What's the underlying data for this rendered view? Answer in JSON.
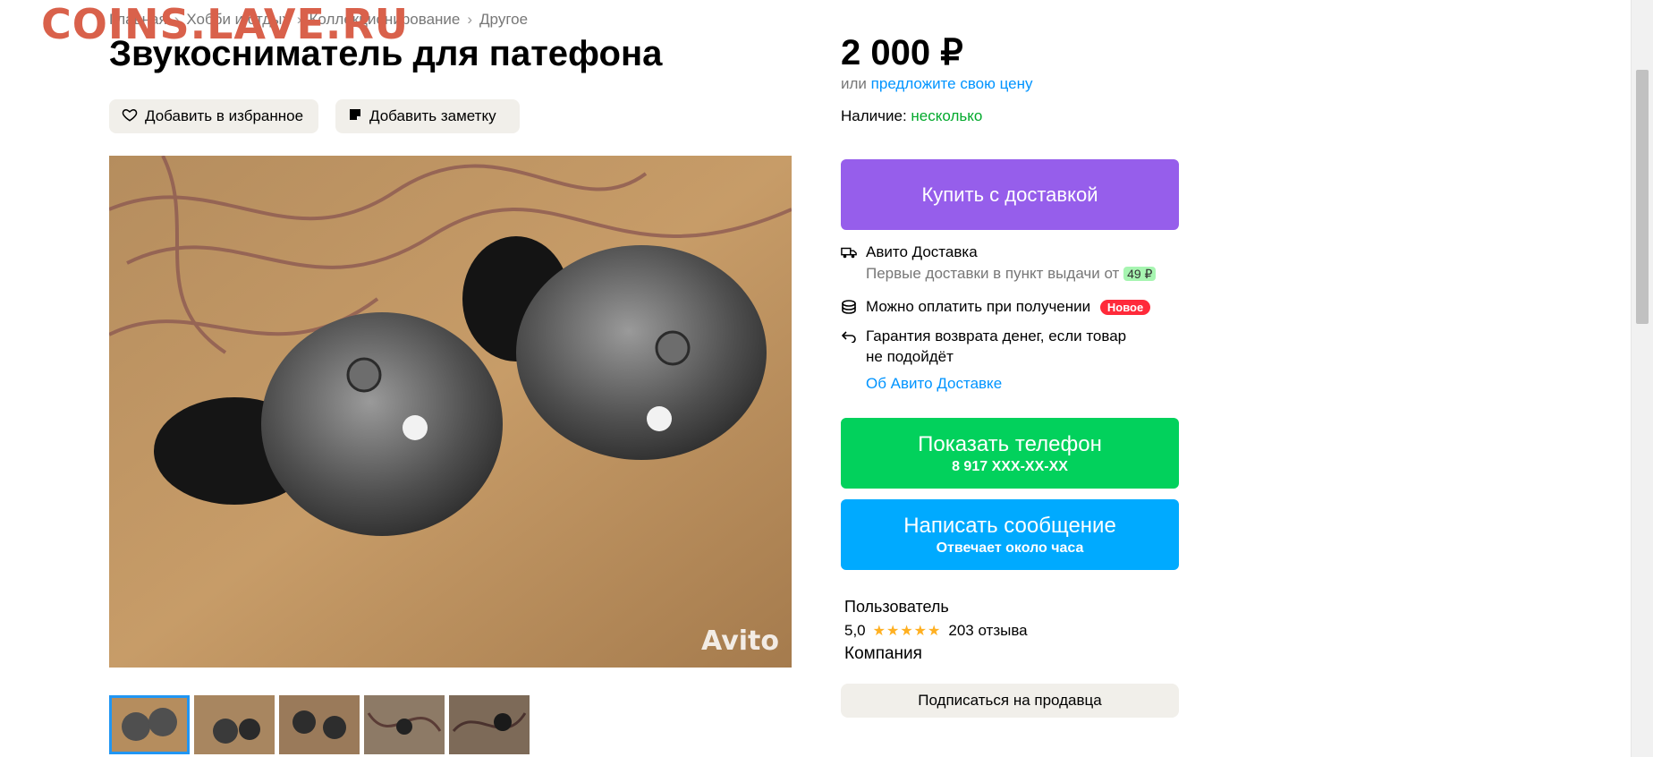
{
  "watermark": "COINS.LAVE.RU",
  "breadcrumb": [
    "Главная",
    "Хобби и отдых",
    "Коллекционирование",
    "Другое"
  ],
  "title": "Звукосниматель для патефона",
  "actions": {
    "favorite": "Добавить в избранное",
    "note": "Добавить заметку"
  },
  "photo": {
    "watermark": "Avito"
  },
  "price": {
    "value": "2 000 ₽",
    "offer_prefix": "или",
    "offer_link": "предложите свою цену"
  },
  "availability": {
    "label": "Наличие:",
    "value": "несколько"
  },
  "buy_button": "Купить с доставкой",
  "delivery": {
    "title": "Авито Доставка",
    "subtitle": "Первые доставки в пункт выдачи от",
    "price_chip": "49 ₽",
    "pay_on_receipt": "Можно оплатить при получении",
    "new_badge": "Новое",
    "guarantee_line1": "Гарантия возврата денег, если товар",
    "guarantee_line2": "не подойдёт",
    "about_link": "Об Авито Доставке"
  },
  "phone_button": {
    "label": "Показать телефон",
    "number": "8 917 XXX-XX-XX"
  },
  "message_button": {
    "label": "Написать сообщение",
    "sub": "Отвечает около часа"
  },
  "seller": {
    "type": "Пользователь",
    "rating": "5,0",
    "stars": "★★★★★",
    "reviews": "203 отзыва",
    "company": "Компания"
  },
  "subscribe_button": "Подписаться на продавца",
  "colors": {
    "buy": "#965eeb",
    "phone": "#02d15c",
    "message": "#00aaff",
    "link": "#0094ff",
    "available": "#02a92c"
  },
  "thumbnails_count": 5
}
